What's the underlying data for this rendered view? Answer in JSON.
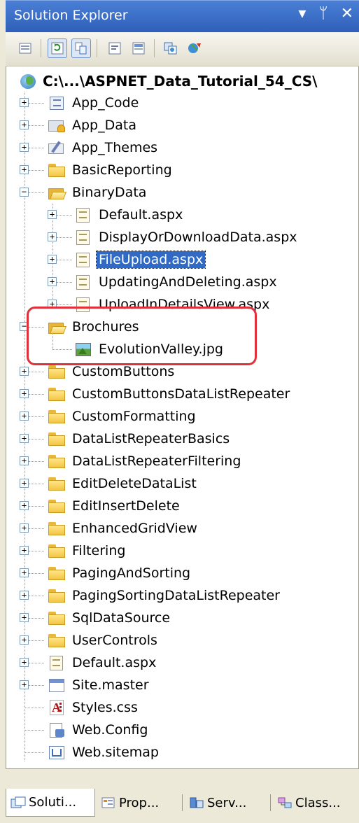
{
  "window": {
    "title": "Solution Explorer",
    "controls": {
      "menu": "▾",
      "pin": "ᛘ",
      "close": "✕"
    }
  },
  "toolbar": {
    "buttons": [
      "properties-icon",
      "refresh-icon",
      "nest-related-files-icon",
      "view-code-icon",
      "view-designer-icon",
      "copy-website-icon",
      "asp-net-configuration-icon"
    ]
  },
  "tree": {
    "root": "C:\\...\\ASPNET_Data_Tutorial_54_CS\\",
    "items": [
      {
        "label": "App_Code"
      },
      {
        "label": "App_Data"
      },
      {
        "label": "App_Themes"
      },
      {
        "label": "BasicReporting"
      },
      {
        "label": "BinaryData"
      },
      {
        "label": "Default.aspx"
      },
      {
        "label": "DisplayOrDownloadData.aspx"
      },
      {
        "label": "FileUpload.aspx"
      },
      {
        "label": "UpdatingAndDeleting.aspx"
      },
      {
        "label": "UploadInDetailsView.aspx"
      },
      {
        "label": "Brochures"
      },
      {
        "label": "EvolutionValley.jpg"
      },
      {
        "label": "CustomButtons"
      },
      {
        "label": "CustomButtonsDataListRepeater"
      },
      {
        "label": "CustomFormatting"
      },
      {
        "label": "DataListRepeaterBasics"
      },
      {
        "label": "DataListRepeaterFiltering"
      },
      {
        "label": "EditDeleteDataList"
      },
      {
        "label": "EditInsertDelete"
      },
      {
        "label": "EnhancedGridView"
      },
      {
        "label": "Filtering"
      },
      {
        "label": "PagingAndSorting"
      },
      {
        "label": "PagingSortingDataListRepeater"
      },
      {
        "label": "SqlDataSource"
      },
      {
        "label": "UserControls"
      },
      {
        "label": "Default.aspx"
      },
      {
        "label": "Site.master"
      },
      {
        "label": "Styles.css"
      },
      {
        "label": "Web.Config"
      },
      {
        "label": "Web.sitemap"
      }
    ]
  },
  "tabs": [
    {
      "label": "Soluti..."
    },
    {
      "label": "Prop..."
    },
    {
      "label": "Serv..."
    },
    {
      "label": "Class..."
    }
  ],
  "colors": {
    "selection": "#316ac5",
    "highlight_border": "#e0303a",
    "titlebar": "#3a6cc6"
  }
}
